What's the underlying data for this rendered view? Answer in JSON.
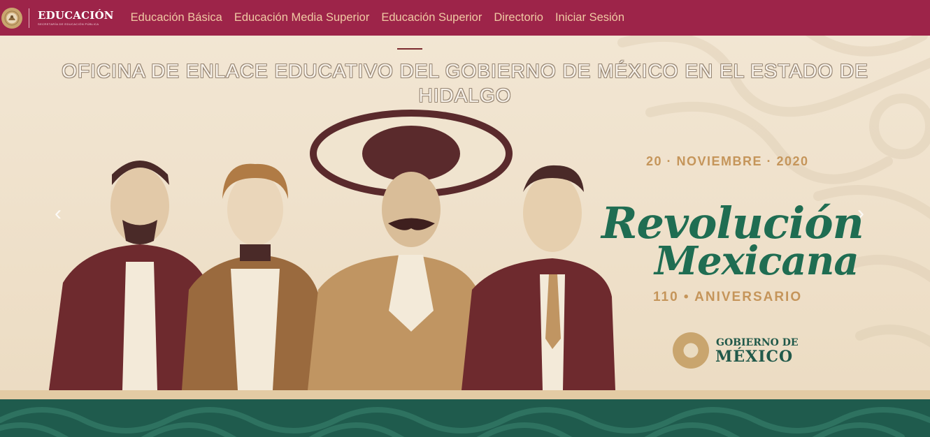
{
  "header": {
    "brand_title": "EDUCACIÓN",
    "brand_subtitle": "SECRETARÍA DE EDUCACIÓN PÚBLICA",
    "nav": [
      {
        "label": "Educación Básica"
      },
      {
        "label": "Educación Media Superior"
      },
      {
        "label": "Educación Superior"
      },
      {
        "label": "Directorio"
      },
      {
        "label": "Iniciar Sesión"
      }
    ]
  },
  "hero": {
    "title_line1": "OFICINA DE ENLACE EDUCATIVO DEL GOBIERNO DE MÉXICO EN EL ESTADO DE",
    "title_line2": "HIDALGO",
    "banner": {
      "date": "20 · NOVIEMBRE · 2020",
      "headline_1": "Revolución",
      "headline_2": "Mexicana",
      "anniversary": "110 • ANIVERSARIO",
      "gov_line1": "GOBIERNO DE",
      "gov_line2": "MÉXICO"
    },
    "prev_glyph": "‹",
    "next_glyph": "›"
  },
  "colors": {
    "nav_bg": "#9d2449",
    "nav_link": "#f0c9a3",
    "banner_green": "#1f6d52",
    "banner_gold": "#c5955a",
    "footer_green": "#1f5b4d"
  },
  "icons": [
    "seal-icon",
    "carousel-prev-icon",
    "carousel-next-icon",
    "gov-seal-icon"
  ]
}
